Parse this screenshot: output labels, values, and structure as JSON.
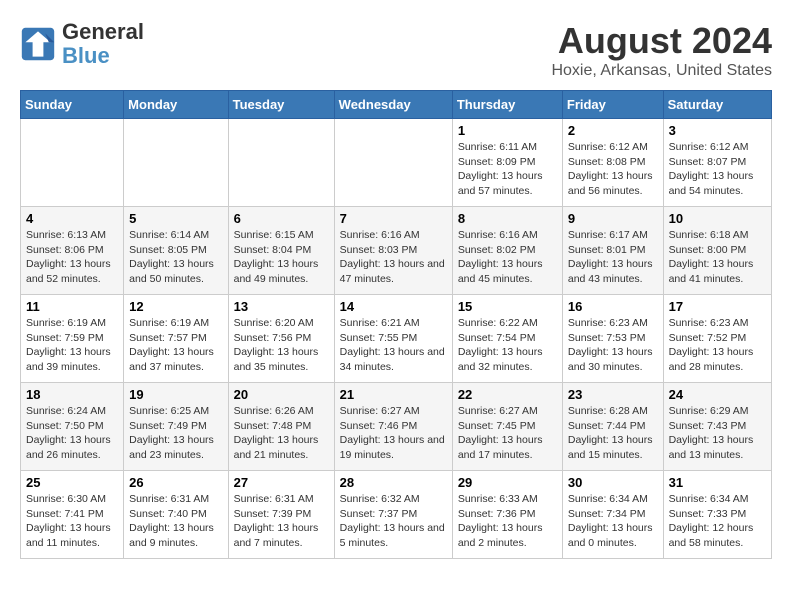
{
  "logo": {
    "text_general": "General",
    "text_blue": "Blue"
  },
  "title": "August 2024",
  "subtitle": "Hoxie, Arkansas, United States",
  "days_header": [
    "Sunday",
    "Monday",
    "Tuesday",
    "Wednesday",
    "Thursday",
    "Friday",
    "Saturday"
  ],
  "weeks": [
    [
      {
        "day": "",
        "sunrise": "",
        "sunset": "",
        "daylight": ""
      },
      {
        "day": "",
        "sunrise": "",
        "sunset": "",
        "daylight": ""
      },
      {
        "day": "",
        "sunrise": "",
        "sunset": "",
        "daylight": ""
      },
      {
        "day": "",
        "sunrise": "",
        "sunset": "",
        "daylight": ""
      },
      {
        "day": "1",
        "sunrise": "Sunrise: 6:11 AM",
        "sunset": "Sunset: 8:09 PM",
        "daylight": "Daylight: 13 hours and 57 minutes."
      },
      {
        "day": "2",
        "sunrise": "Sunrise: 6:12 AM",
        "sunset": "Sunset: 8:08 PM",
        "daylight": "Daylight: 13 hours and 56 minutes."
      },
      {
        "day": "3",
        "sunrise": "Sunrise: 6:12 AM",
        "sunset": "Sunset: 8:07 PM",
        "daylight": "Daylight: 13 hours and 54 minutes."
      }
    ],
    [
      {
        "day": "4",
        "sunrise": "Sunrise: 6:13 AM",
        "sunset": "Sunset: 8:06 PM",
        "daylight": "Daylight: 13 hours and 52 minutes."
      },
      {
        "day": "5",
        "sunrise": "Sunrise: 6:14 AM",
        "sunset": "Sunset: 8:05 PM",
        "daylight": "Daylight: 13 hours and 50 minutes."
      },
      {
        "day": "6",
        "sunrise": "Sunrise: 6:15 AM",
        "sunset": "Sunset: 8:04 PM",
        "daylight": "Daylight: 13 hours and 49 minutes."
      },
      {
        "day": "7",
        "sunrise": "Sunrise: 6:16 AM",
        "sunset": "Sunset: 8:03 PM",
        "daylight": "Daylight: 13 hours and 47 minutes."
      },
      {
        "day": "8",
        "sunrise": "Sunrise: 6:16 AM",
        "sunset": "Sunset: 8:02 PM",
        "daylight": "Daylight: 13 hours and 45 minutes."
      },
      {
        "day": "9",
        "sunrise": "Sunrise: 6:17 AM",
        "sunset": "Sunset: 8:01 PM",
        "daylight": "Daylight: 13 hours and 43 minutes."
      },
      {
        "day": "10",
        "sunrise": "Sunrise: 6:18 AM",
        "sunset": "Sunset: 8:00 PM",
        "daylight": "Daylight: 13 hours and 41 minutes."
      }
    ],
    [
      {
        "day": "11",
        "sunrise": "Sunrise: 6:19 AM",
        "sunset": "Sunset: 7:59 PM",
        "daylight": "Daylight: 13 hours and 39 minutes."
      },
      {
        "day": "12",
        "sunrise": "Sunrise: 6:19 AM",
        "sunset": "Sunset: 7:57 PM",
        "daylight": "Daylight: 13 hours and 37 minutes."
      },
      {
        "day": "13",
        "sunrise": "Sunrise: 6:20 AM",
        "sunset": "Sunset: 7:56 PM",
        "daylight": "Daylight: 13 hours and 35 minutes."
      },
      {
        "day": "14",
        "sunrise": "Sunrise: 6:21 AM",
        "sunset": "Sunset: 7:55 PM",
        "daylight": "Daylight: 13 hours and 34 minutes."
      },
      {
        "day": "15",
        "sunrise": "Sunrise: 6:22 AM",
        "sunset": "Sunset: 7:54 PM",
        "daylight": "Daylight: 13 hours and 32 minutes."
      },
      {
        "day": "16",
        "sunrise": "Sunrise: 6:23 AM",
        "sunset": "Sunset: 7:53 PM",
        "daylight": "Daylight: 13 hours and 30 minutes."
      },
      {
        "day": "17",
        "sunrise": "Sunrise: 6:23 AM",
        "sunset": "Sunset: 7:52 PM",
        "daylight": "Daylight: 13 hours and 28 minutes."
      }
    ],
    [
      {
        "day": "18",
        "sunrise": "Sunrise: 6:24 AM",
        "sunset": "Sunset: 7:50 PM",
        "daylight": "Daylight: 13 hours and 26 minutes."
      },
      {
        "day": "19",
        "sunrise": "Sunrise: 6:25 AM",
        "sunset": "Sunset: 7:49 PM",
        "daylight": "Daylight: 13 hours and 23 minutes."
      },
      {
        "day": "20",
        "sunrise": "Sunrise: 6:26 AM",
        "sunset": "Sunset: 7:48 PM",
        "daylight": "Daylight: 13 hours and 21 minutes."
      },
      {
        "day": "21",
        "sunrise": "Sunrise: 6:27 AM",
        "sunset": "Sunset: 7:46 PM",
        "daylight": "Daylight: 13 hours and 19 minutes."
      },
      {
        "day": "22",
        "sunrise": "Sunrise: 6:27 AM",
        "sunset": "Sunset: 7:45 PM",
        "daylight": "Daylight: 13 hours and 17 minutes."
      },
      {
        "day": "23",
        "sunrise": "Sunrise: 6:28 AM",
        "sunset": "Sunset: 7:44 PM",
        "daylight": "Daylight: 13 hours and 15 minutes."
      },
      {
        "day": "24",
        "sunrise": "Sunrise: 6:29 AM",
        "sunset": "Sunset: 7:43 PM",
        "daylight": "Daylight: 13 hours and 13 minutes."
      }
    ],
    [
      {
        "day": "25",
        "sunrise": "Sunrise: 6:30 AM",
        "sunset": "Sunset: 7:41 PM",
        "daylight": "Daylight: 13 hours and 11 minutes."
      },
      {
        "day": "26",
        "sunrise": "Sunrise: 6:31 AM",
        "sunset": "Sunset: 7:40 PM",
        "daylight": "Daylight: 13 hours and 9 minutes."
      },
      {
        "day": "27",
        "sunrise": "Sunrise: 6:31 AM",
        "sunset": "Sunset: 7:39 PM",
        "daylight": "Daylight: 13 hours and 7 minutes."
      },
      {
        "day": "28",
        "sunrise": "Sunrise: 6:32 AM",
        "sunset": "Sunset: 7:37 PM",
        "daylight": "Daylight: 13 hours and 5 minutes."
      },
      {
        "day": "29",
        "sunrise": "Sunrise: 6:33 AM",
        "sunset": "Sunset: 7:36 PM",
        "daylight": "Daylight: 13 hours and 2 minutes."
      },
      {
        "day": "30",
        "sunrise": "Sunrise: 6:34 AM",
        "sunset": "Sunset: 7:34 PM",
        "daylight": "Daylight: 13 hours and 0 minutes."
      },
      {
        "day": "31",
        "sunrise": "Sunrise: 6:34 AM",
        "sunset": "Sunset: 7:33 PM",
        "daylight": "Daylight: 12 hours and 58 minutes."
      }
    ]
  ]
}
